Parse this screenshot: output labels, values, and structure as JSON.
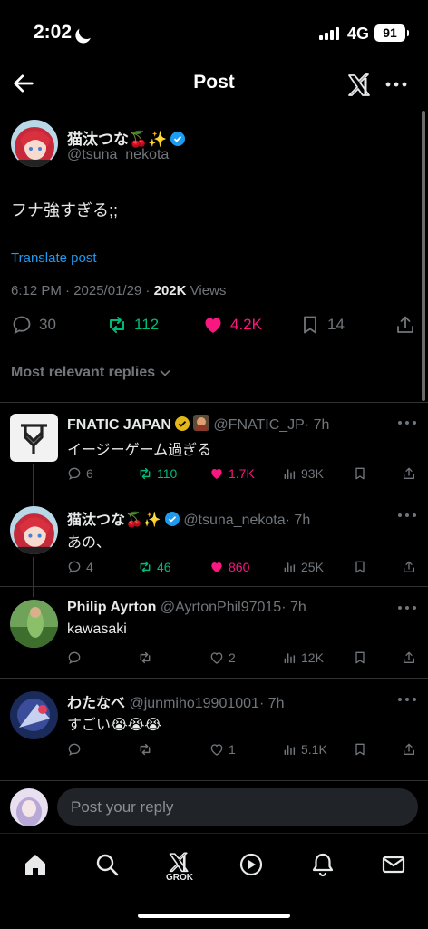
{
  "status_bar": {
    "time": "2:02",
    "network": "4G",
    "battery": "91"
  },
  "header": {
    "title": "Post"
  },
  "post": {
    "author_name": "猫汰つな🍒✨",
    "author_handle": "@tsuna_nekota",
    "text": "フナ強すぎる;;",
    "translate_label": "Translate post",
    "time": "6:12 PM · 2025/01/29 · ",
    "views_count": "202K",
    "views_label": " Views",
    "replies": "30",
    "reposts": "112",
    "likes": "4.2K",
    "bookmarks": "14"
  },
  "sort_label": "Most relevant replies",
  "replies": [
    {
      "name": "FNATIC JAPAN",
      "handle": "@FNATIC_JP",
      "time": "· 7h",
      "text": "イージーゲーム過ぎる",
      "replies": "6",
      "reposts": "110",
      "likes": "1.7K",
      "views": "93K"
    },
    {
      "name": "猫汰つな🍒✨",
      "handle": "@tsuna_nekota",
      "time": "· 7h",
      "text": "あの、",
      "replies": "4",
      "reposts": "46",
      "likes": "860",
      "views": "25K"
    },
    {
      "name": "Philip Ayrton",
      "handle": "@AyrtonPhil97015",
      "time": "· 7h",
      "text": "kawasaki",
      "replies": "",
      "reposts": "",
      "likes": "2",
      "views": "12K"
    },
    {
      "name": "わたなべ",
      "handle": "@junmiho19901001",
      "time": "· 7h",
      "text": "すごい😭😭😭",
      "replies": "",
      "reposts": "",
      "likes": "1",
      "views": "5.1K"
    }
  ],
  "compose": {
    "placeholder": "Post your reply"
  },
  "tabbar": {
    "grok_label": "GROK"
  },
  "colors": {
    "accent": "#1d9bf0",
    "repost": "#00ba7c",
    "like": "#f91880",
    "muted": "#71767b",
    "background": "#000000"
  }
}
